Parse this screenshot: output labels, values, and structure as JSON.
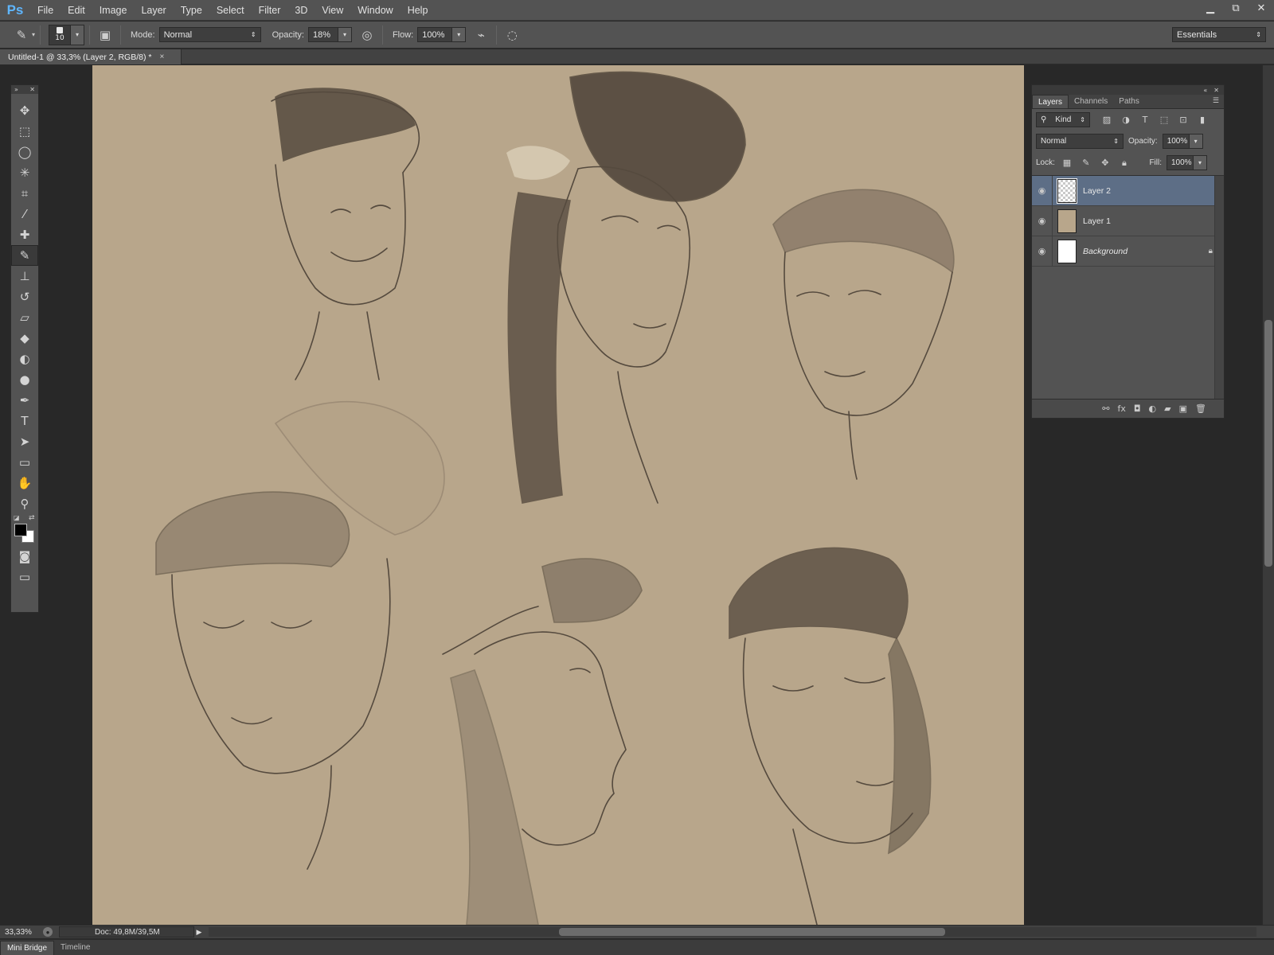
{
  "app": {
    "logo": "Ps"
  },
  "menu": [
    "File",
    "Edit",
    "Image",
    "Layer",
    "Type",
    "Select",
    "Filter",
    "3D",
    "View",
    "Window",
    "Help"
  ],
  "window_controls": {
    "minimize": "▁",
    "restore": "⧉",
    "close": "✕"
  },
  "options": {
    "brush_size": "10",
    "mode_label": "Mode:",
    "mode_value": "Normal",
    "opacity_label": "Opacity:",
    "opacity_value": "18%",
    "flow_label": "Flow:",
    "flow_value": "100%",
    "workspace": "Essentials"
  },
  "document": {
    "tab_title": "Untitled-1 @ 33,3% (Layer 2, RGB/8) *",
    "close": "×"
  },
  "tools": [
    {
      "name": "move-tool",
      "icon": "✥"
    },
    {
      "name": "marquee-tool",
      "icon": "⬚"
    },
    {
      "name": "lasso-tool",
      "icon": "◯"
    },
    {
      "name": "magic-wand-tool",
      "icon": "✳"
    },
    {
      "name": "crop-tool",
      "icon": "⌗"
    },
    {
      "name": "eyedropper-tool",
      "icon": "⁄"
    },
    {
      "name": "healing-brush-tool",
      "icon": "✚"
    },
    {
      "name": "brush-tool",
      "icon": "✎",
      "active": true
    },
    {
      "name": "clone-stamp-tool",
      "icon": "⊥"
    },
    {
      "name": "history-brush-tool",
      "icon": "↺"
    },
    {
      "name": "eraser-tool",
      "icon": "▱"
    },
    {
      "name": "paint-bucket-tool",
      "icon": "◆"
    },
    {
      "name": "blur-tool",
      "icon": "◐"
    },
    {
      "name": "dodge-tool",
      "icon": "●"
    },
    {
      "name": "pen-tool",
      "icon": "✒"
    },
    {
      "name": "type-tool",
      "icon": "T"
    },
    {
      "name": "path-selection-tool",
      "icon": "➤"
    },
    {
      "name": "rectangle-tool",
      "icon": "▭"
    },
    {
      "name": "hand-tool",
      "icon": "✋"
    },
    {
      "name": "zoom-tool",
      "icon": "⚲"
    }
  ],
  "layers_panel": {
    "tabs": [
      "Layers",
      "Channels",
      "Paths"
    ],
    "active_tab": "Layers",
    "filter_kind": "Kind",
    "blend_mode": "Normal",
    "opacity_label": "Opacity:",
    "opacity_value": "100%",
    "lock_label": "Lock:",
    "fill_label": "Fill:",
    "fill_value": "100%",
    "layers": [
      {
        "name": "Layer 2",
        "selected": true,
        "thumb": "transparent"
      },
      {
        "name": "Layer 1",
        "selected": false,
        "thumb": "tan"
      },
      {
        "name": "Background",
        "selected": false,
        "thumb": "white",
        "locked": true
      }
    ]
  },
  "status": {
    "zoom": "33,33%",
    "doc_info": "Doc: 49,8M/39,5M"
  },
  "bottom_tabs": [
    "Mini Bridge",
    "Timeline"
  ],
  "colors": {
    "canvas": "#b8a68b",
    "foreground": "#000000",
    "background": "#ffffff",
    "selected_layer": "#5d6e86"
  }
}
